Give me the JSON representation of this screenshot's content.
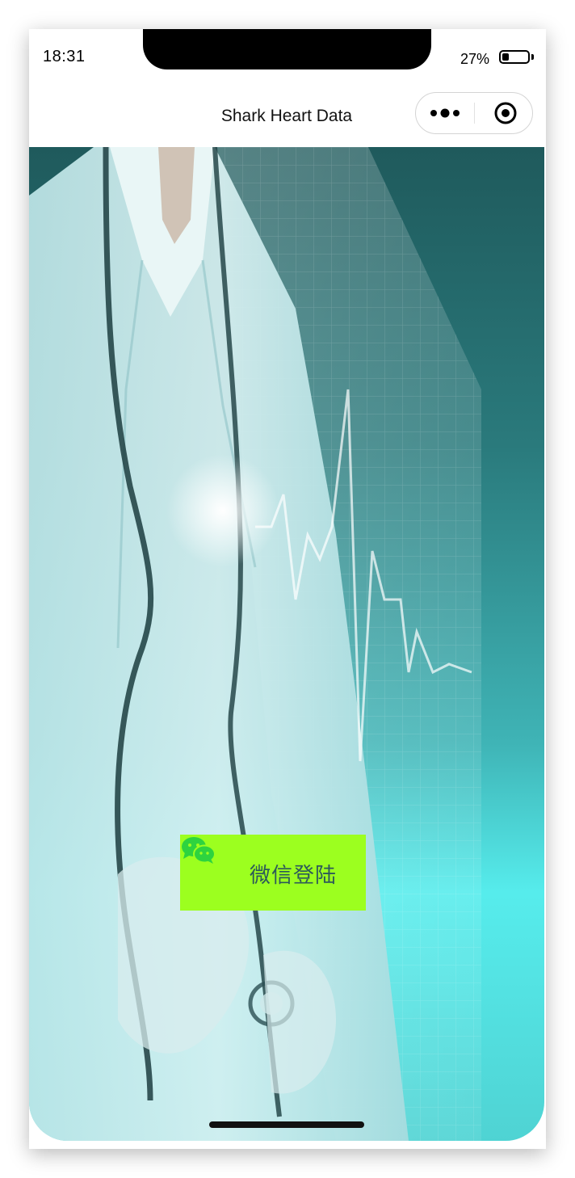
{
  "status_bar": {
    "time": "18:31",
    "battery_percent_label": "27%",
    "battery_level": 0.27
  },
  "nav_bar": {
    "title": "Shark Heart Data",
    "more_icon": "more-dots-icon",
    "close_icon": "target-circle-icon"
  },
  "main": {
    "background_image": "doctor-stethoscope-ecg-hero",
    "login_button_label": "微信登陆",
    "login_button_icon": "wechat-icon",
    "login_button_color": "#9cff1f",
    "login_label_color": "#2d5a5a"
  }
}
